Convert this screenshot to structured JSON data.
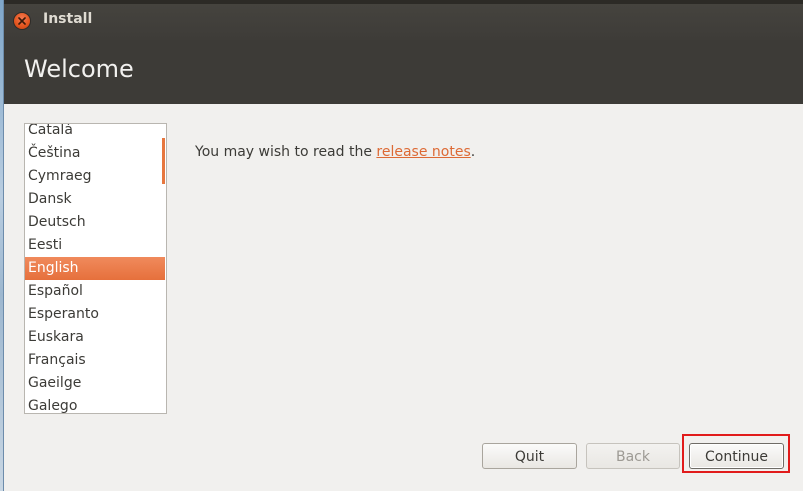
{
  "window": {
    "title": "Install"
  },
  "header": {
    "title": "Welcome"
  },
  "languages": {
    "items": [
      "Català",
      "Čeština",
      "Cymraeg",
      "Dansk",
      "Deutsch",
      "Eesti",
      "English",
      "Español",
      "Esperanto",
      "Euskara",
      "Français",
      "Gaeilge",
      "Galego"
    ],
    "selected": "English"
  },
  "main": {
    "release_prefix": "You may wish to read the ",
    "release_link": "release notes",
    "release_suffix": "."
  },
  "buttons": {
    "quit": "Quit",
    "back": "Back",
    "continue": "Continue"
  },
  "colors": {
    "accent": "#e6703c",
    "header_bg": "#3d3b37",
    "highlight": "#e11b1b"
  },
  "icons": {
    "close": "close-icon"
  }
}
